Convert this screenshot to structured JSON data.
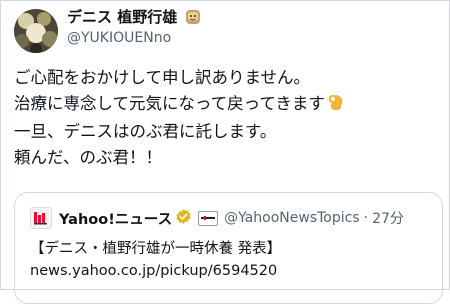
{
  "tweet": {
    "display_name": "デニス 植野行雄",
    "handle": "@YUKIOUENno",
    "name_icon": "person-emoji-icon",
    "lines": [
      "ご心配をおかけして申し訳ありません。",
      "治療に専念して元気になって戻ってきます",
      "一旦、デニスはのぶ君に託します。",
      "頼んだ、のぶ君！！"
    ],
    "line2_emoji": "ok-hand-icon"
  },
  "quoted": {
    "name": "Yahoo!ニュース",
    "handle": "@YahooNewsTopics",
    "separator": "·",
    "time": "27分",
    "headline": "【デニス・植野行雄が一時休養 発表】",
    "link": "news.yahoo.co.jp/pickup/6594520",
    "colors": {
      "verified": "#e2b719",
      "logo_red": "#ff0033"
    }
  }
}
